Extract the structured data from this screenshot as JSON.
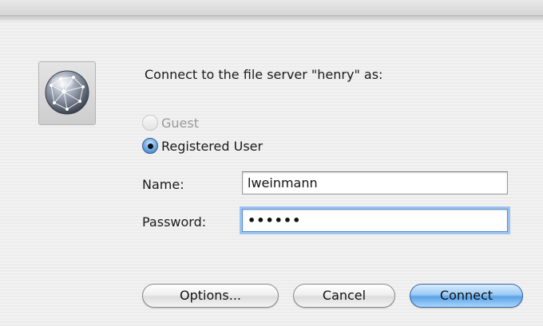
{
  "dialog": {
    "prompt": "Connect to the file server \"henry\" as:",
    "server_icon": "network-globe-icon"
  },
  "auth": {
    "guest_label": "Guest",
    "guest_enabled": false,
    "registered_label": "Registered User",
    "selected": "registered"
  },
  "form": {
    "name_label": "Name:",
    "name_value": "lweinmann",
    "password_label": "Password:",
    "password_value": "••••••"
  },
  "buttons": {
    "options_label": "Options...",
    "cancel_label": "Cancel",
    "connect_label": "Connect"
  },
  "colors": {
    "accent": "#5aa2e8",
    "focus_ring": "#9cc3ef"
  }
}
